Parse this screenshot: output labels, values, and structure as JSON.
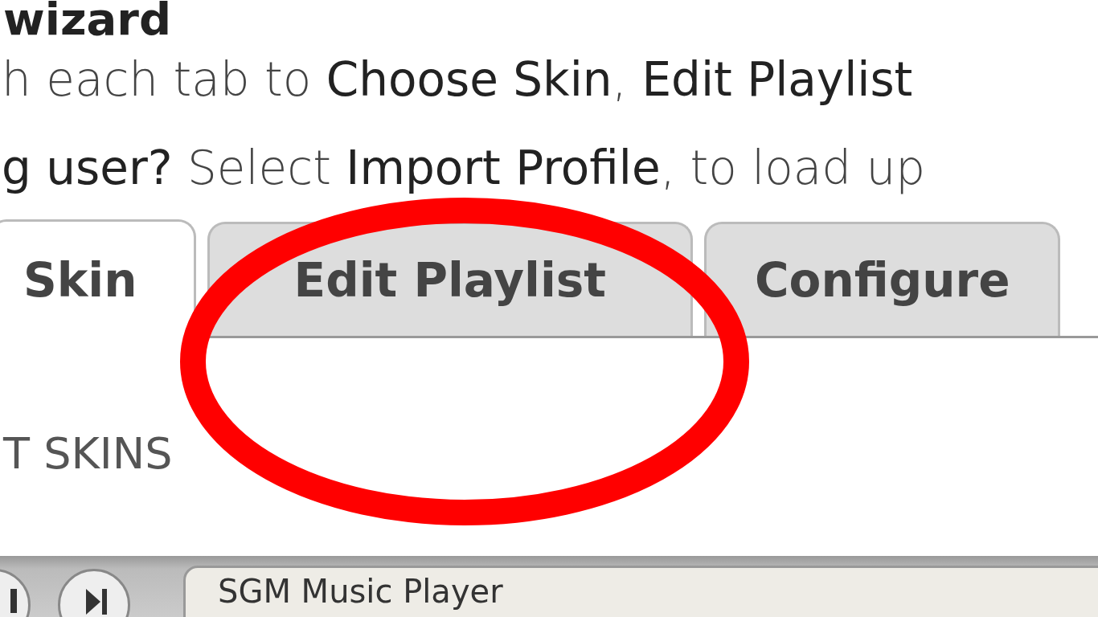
{
  "heading": "wizard",
  "intro_lines": [
    "h each tab to **Choose Skin**, **Edit Playlist**",
    "**g user?** Select **Import Profile**, to load up"
  ],
  "tabs": [
    {
      "label": "Skin",
      "selected": true
    },
    {
      "label": "Edit Playlist",
      "selected": false
    },
    {
      "label": "Configure",
      "selected": false
    }
  ],
  "section_title": "T SKINS",
  "player": {
    "title": "SGM Music Player"
  }
}
